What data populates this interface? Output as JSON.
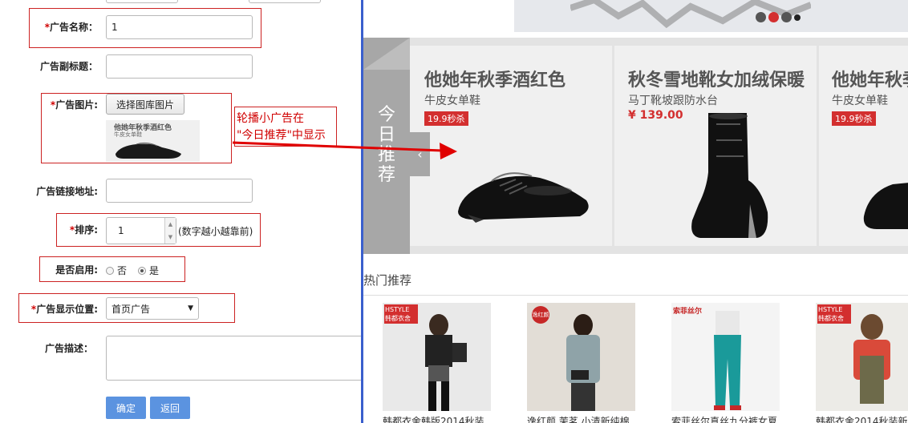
{
  "form": {
    "name_label": "广告名称：",
    "name_value": "1",
    "subtitle_label": "广告副标题：",
    "image_label": "广告图片:",
    "choose_image_button": "选择图库图片",
    "preview_title": "他她年秋季酒红色",
    "preview_sub": "牛皮女单鞋",
    "link_label": "广告链接地址:",
    "order_label": "排序:",
    "order_value": "1",
    "order_hint": "(数字越小越靠前)",
    "enabled_label": "是否启用:",
    "enabled_no": "否",
    "enabled_yes": "是",
    "enabled_selected": "yes",
    "position_label": "广告显示位置:",
    "position_value": "首页广告",
    "desc_label": "广告描述：",
    "confirm_button": "确定",
    "back_button": "返回",
    "required_mark": "*"
  },
  "annotation": {
    "line1": "轮播小广告在",
    "line2": "\"今日推荐\"中显示",
    "arrow_color": "#e00000"
  },
  "preview": {
    "today_label_chars": [
      "今",
      "日",
      "推",
      "荐"
    ],
    "products": [
      {
        "title": "他她年秋季酒红色",
        "sub": "牛皮女单鞋",
        "tag": "19.9秒杀",
        "price": ""
      },
      {
        "title": "秋冬雪地靴女加绒保暖",
        "sub": "马丁靴坡跟防水台",
        "tag": "",
        "price": "¥ 139.00"
      },
      {
        "title": "他她年秋季",
        "sub": "牛皮女单鞋",
        "tag": "19.9秒杀",
        "price": ""
      }
    ],
    "hot_title": "热门推荐",
    "hot_items": [
      {
        "brand": "HSTYLE 韩都衣舍",
        "caption": "韩都衣舍韩版2014秋装"
      },
      {
        "brand": "逸红颜",
        "caption": "逸红颜 茉茗 小清新纯棉"
      },
      {
        "brand": "索菲丝尔",
        "caption": "索菲丝尔真丝九分裤女夏"
      },
      {
        "brand": "HSTYLE 韩都衣舍",
        "caption": "韩都衣舍2014秋装新"
      }
    ]
  },
  "colors": {
    "accent_blue": "#5b93e0",
    "red": "#d32f2f",
    "divider": "#3a5fcd"
  }
}
